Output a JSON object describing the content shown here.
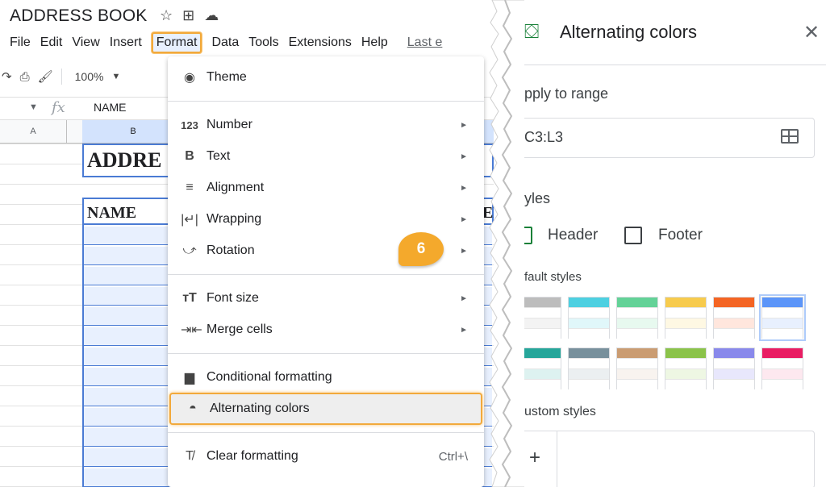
{
  "sheet": {
    "doc_title": "ADDRESS BOOK",
    "menu": [
      "File",
      "Edit",
      "View",
      "Insert",
      "Format",
      "Data",
      "Tools",
      "Extensions",
      "Help"
    ],
    "last_edit": "Last e",
    "zoom": "100%",
    "fx": "fx",
    "formula_value": "NAME",
    "col_a": "A",
    "col_b": "B",
    "title_cell": "ADDRE",
    "header_cell": "NAME",
    "header_cell_2": "EM"
  },
  "format_menu": {
    "items": [
      {
        "label": "Theme",
        "icon": "palette-icon"
      },
      {
        "label": "Number",
        "icon": "number-format-icon",
        "glyph": "123"
      },
      {
        "label": "Text",
        "icon": "bold-icon",
        "glyph": "B"
      },
      {
        "label": "Alignment",
        "icon": "align-icon"
      },
      {
        "label": "Wrapping",
        "icon": "wrap-icon"
      },
      {
        "label": "Rotation",
        "icon": "text-rotation-icon"
      },
      {
        "label": "Font size",
        "icon": "font-size-icon",
        "glyph": "тT"
      },
      {
        "label": "Merge cells",
        "icon": "merge-cells-icon"
      },
      {
        "label": "Conditional formatting",
        "icon": "paint-roller-icon"
      },
      {
        "label": "Alternating colors",
        "icon": "color-drop-icon"
      },
      {
        "label": "Clear formatting",
        "icon": "clear-format-icon",
        "shortcut": "Ctrl+\\"
      }
    ]
  },
  "step_badge": "6",
  "panel": {
    "title": "Alternating colors",
    "apply_label": "pply to range",
    "range_value": "C3:L3",
    "styles_label": "yles",
    "header_label": "Header",
    "footer_label": "Footer",
    "default_styles_label": "fault styles",
    "custom_styles_label": "ustom styles",
    "add_label": "+"
  },
  "swatches": [
    [
      "#bdbdbd",
      "#f3f3f3"
    ],
    [
      "#4dd0e1",
      "#e0f7fa"
    ],
    [
      "#63d297",
      "#e7f9ef"
    ],
    [
      "#f7cb4d",
      "#fef8e3"
    ],
    [
      "#f46524",
      "#ffe6dd"
    ],
    [
      "#5b95f9",
      "#e8f0fe"
    ],
    [
      "#26a69a",
      "#ddf2f0"
    ],
    [
      "#78909c",
      "#ebeff1"
    ],
    [
      "#ca9c72",
      "#f8f3ef"
    ],
    [
      "#8bc34a",
      "#eef7e3"
    ],
    [
      "#8989eb",
      "#e8e7fc"
    ],
    [
      "#e91d63",
      "#fde8ef"
    ]
  ]
}
